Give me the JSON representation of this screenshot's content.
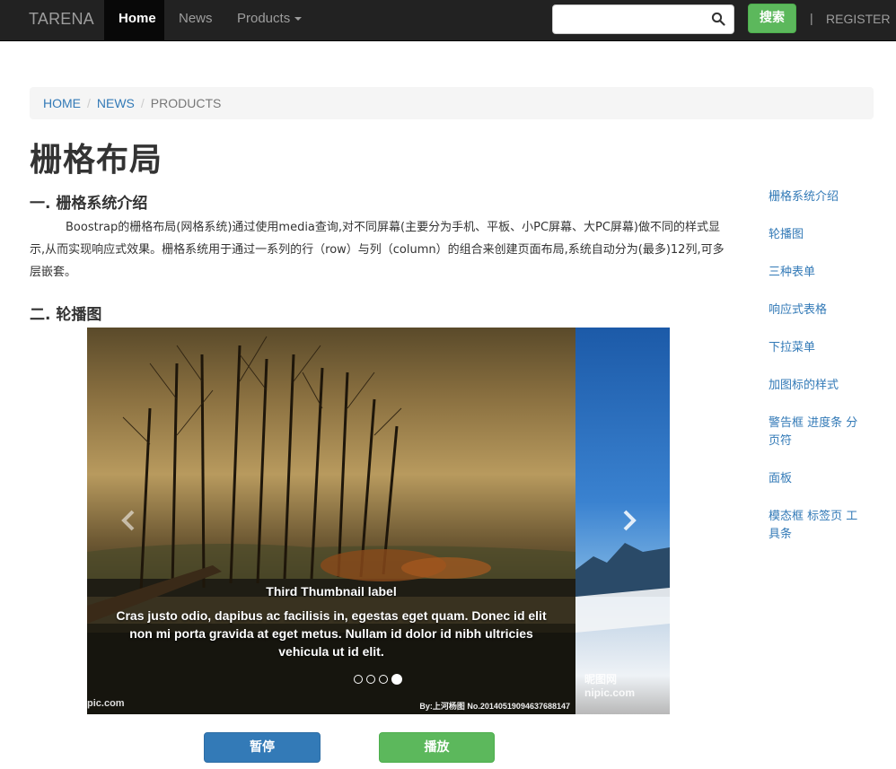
{
  "navbar": {
    "brand": "TARENA",
    "items": [
      {
        "label": "Home",
        "active": true
      },
      {
        "label": "News",
        "active": false
      },
      {
        "label": "Products",
        "active": false,
        "dropdown": true
      }
    ],
    "search": {
      "value": "",
      "placeholder": "",
      "icon": "search-icon"
    },
    "search_button": "搜索",
    "divider": "|",
    "register": "REGISTER"
  },
  "breadcrumb": {
    "items": [
      "HOME",
      "NEWS"
    ],
    "current": "PRODUCTS",
    "separator": "/"
  },
  "page_title": "栅格布局",
  "sections": {
    "grid_title": "一. 栅格系统介绍",
    "grid_text": "Boostrap的栅格布局(网格系统)通过使用media查询,对不同屏幕(主要分为手机、平板、小PC屏幕、大PC屏幕)做不同的样式显示,从而实现响应式效果。栅格系统用于通过一系列的行（row）与列（column）的组合来创建页面布局,系统自动分为(最多)12列,可多层嵌套。",
    "carousel_title": "二. 轮播图"
  },
  "carousel": {
    "caption_title": "Third Thumbnail label",
    "caption_text": "Cras justo odio, dapibus ac facilisis in, egestas eget quam. Donec id elit non mi porta gravida at eget metus. Nullam id dolor id nibh ultricies vehicula ut id elit.",
    "indicator_count": 4,
    "active_indicator": 4,
    "watermark_left": "pic.com",
    "watermark_right": "By:上河杨图 No.20140519094637688147",
    "watermark_next": "昵图网 nipic.com"
  },
  "buttons": {
    "pause": "暂停",
    "play": "播放"
  },
  "sidenav": [
    "栅格系统介绍",
    "轮播图",
    "三种表单",
    "响应式表格",
    "下拉菜单",
    "加图标的样式",
    "警告框 进度条 分页符",
    "面板",
    "模态框 标签页 工具条"
  ],
  "colors": {
    "navbar_bg": "#222222",
    "link": "#337ab7",
    "success": "#5cb85c",
    "primary": "#337ab7"
  }
}
